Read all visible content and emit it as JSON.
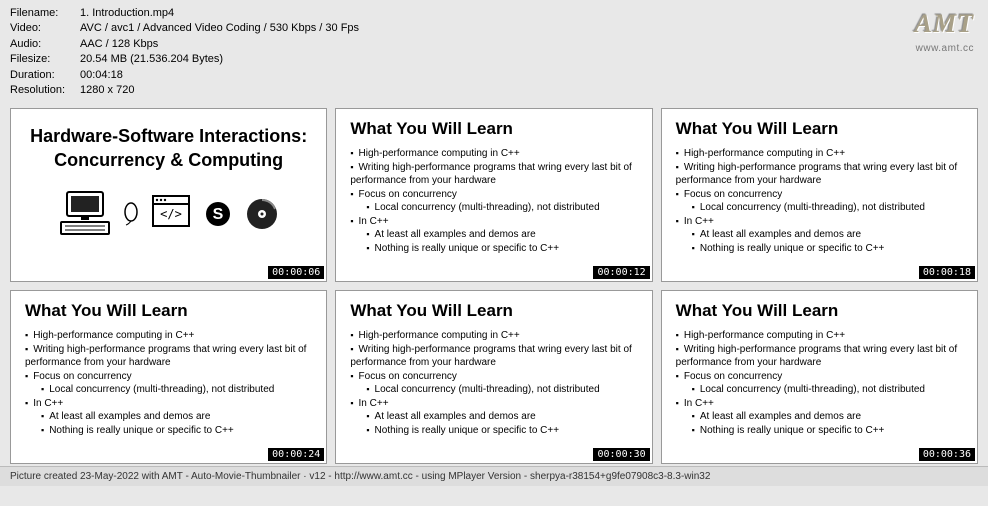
{
  "meta": {
    "filename_label": "Filename:",
    "filename": "1. Introduction.mp4",
    "video_label": "Video:",
    "video": "AVC / avc1 / Advanced Video Coding / 530 Kbps / 30 Fps",
    "audio_label": "Audio:",
    "audio": "AAC / 128 Kbps",
    "filesize_label": "Filesize:",
    "filesize": "20.54 MB (21.536.204 Bytes)",
    "duration_label": "Duration:",
    "duration": "00:04:18",
    "resolution_label": "Resolution:",
    "resolution": "1280 x 720"
  },
  "logo": {
    "text": "AMT",
    "url": "www.amt.cc"
  },
  "slide_title": {
    "line1": "Hardware-Software Interactions:",
    "line2": "Concurrency & Computing"
  },
  "learn_heading": "What You Will Learn",
  "bullets": {
    "b1": "High-performance computing in C++",
    "b2": "Writing high-performance programs that wring every last bit of performance from your hardware",
    "b3": "Focus on concurrency",
    "b3a": "Local concurrency (multi-threading), not distributed",
    "b4": "In C++",
    "b4a": "At least all examples and demos are",
    "b4b": "Nothing is really unique or specific to C++"
  },
  "timestamps": {
    "t1": "00:00:06",
    "t2": "00:00:12",
    "t3": "00:00:18",
    "t4": "00:00:24",
    "t5": "00:00:30",
    "t6": "00:00:36"
  },
  "footer": "Picture created 23-May-2022 with AMT - Auto-Movie-Thumbnailer · v12 - http://www.amt.cc - using MPlayer Version - sherpya-r38154+g9fe07908c3-8.3-win32"
}
